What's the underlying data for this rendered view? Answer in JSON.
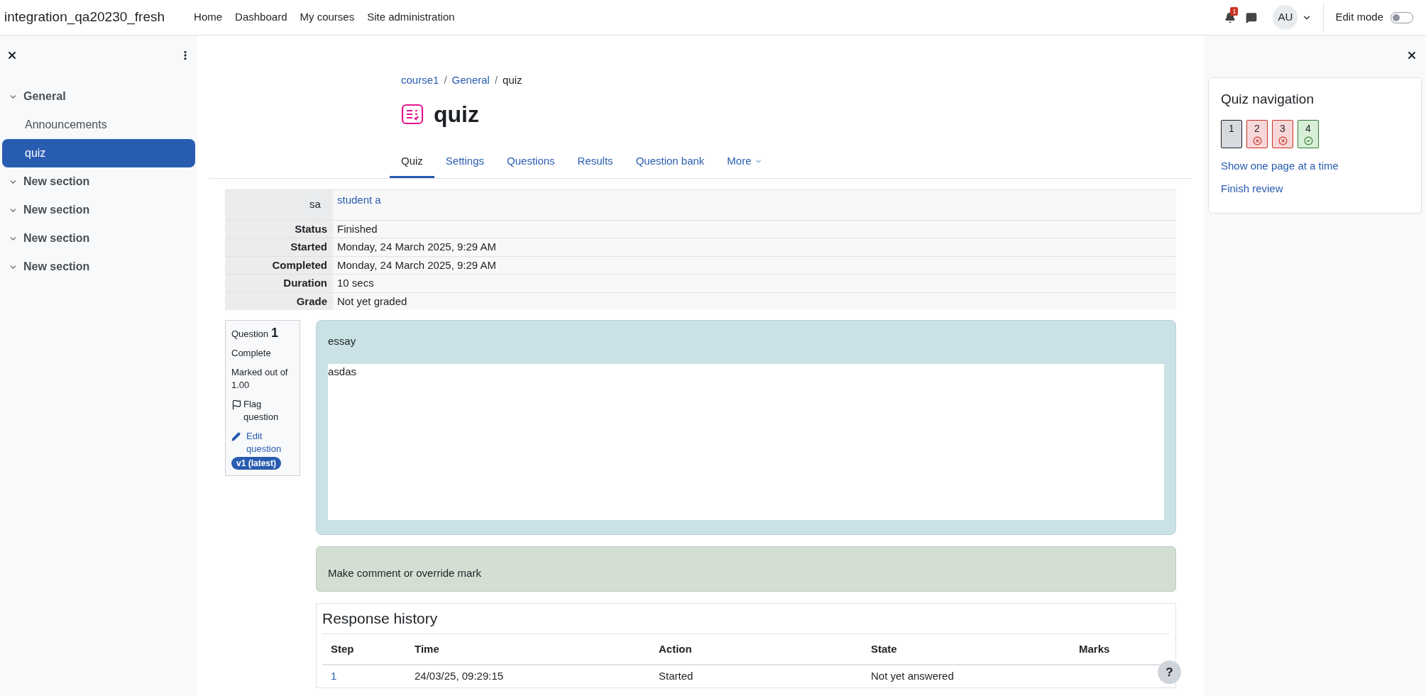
{
  "navbar": {
    "site_name": "integration_qa20230_fresh",
    "links": [
      "Home",
      "Dashboard",
      "My courses",
      "Site administration"
    ],
    "notification_count": "1",
    "avatar": "AU",
    "edit_mode": {
      "label": "Edit mode",
      "on": false
    }
  },
  "course_index": {
    "sections": [
      {
        "title": "General",
        "expanded": true,
        "children": [
          {
            "label": "Announcements",
            "selected": false
          },
          {
            "label": "quiz",
            "selected": true
          }
        ]
      },
      {
        "title": "New section",
        "expanded": true
      },
      {
        "title": "New section",
        "expanded": true
      },
      {
        "title": "New section",
        "expanded": true
      },
      {
        "title": "New section",
        "expanded": true
      }
    ]
  },
  "breadcrumb": {
    "separator": "/",
    "items": [
      "course1",
      "General",
      "quiz"
    ]
  },
  "page_title": "quiz",
  "tabs": [
    {
      "label": "Quiz",
      "selected": true
    },
    {
      "label": "Settings",
      "selected": false
    },
    {
      "label": "Questions",
      "selected": false
    },
    {
      "label": "Results",
      "selected": false
    },
    {
      "label": "Question bank",
      "selected": false
    },
    {
      "label": "More",
      "selected": false
    }
  ],
  "summary": {
    "avatar": "sa",
    "user": "student a",
    "rows": [
      {
        "label": "Status",
        "value": "Finished"
      },
      {
        "label": "Started",
        "value": "Monday, 24 March 2025, 9:29 AM"
      },
      {
        "label": "Completed",
        "value": "Monday, 24 March 2025, 9:29 AM"
      },
      {
        "label": "Duration",
        "value": "10 secs"
      },
      {
        "label": "Grade",
        "value": "Not yet graded"
      }
    ]
  },
  "question": {
    "label": "Question",
    "number": "1",
    "state": "Complete",
    "marked": "Marked out of 1.00",
    "flag": "Flag question",
    "edit": "Edit question",
    "version": "v1 (latest)",
    "text": "essay",
    "answer": "asdas",
    "comment": "Make comment or override mark"
  },
  "response_history": {
    "title": "Response history",
    "columns": [
      "Step",
      "Time",
      "Action",
      "State",
      "Marks"
    ],
    "rows": [
      [
        "1",
        "24/03/25, 09:29:15",
        "Started",
        "Not yet answered",
        ""
      ]
    ]
  },
  "help_button": "?",
  "quiz_navigation": {
    "title": "Quiz navigation",
    "buttons": [
      {
        "label": "1",
        "kind": "current"
      },
      {
        "label": "2",
        "kind": "incorrect"
      },
      {
        "label": "3",
        "kind": "incorrect"
      },
      {
        "label": "4",
        "kind": "correct"
      }
    ],
    "links": [
      "Show one page at a time",
      "Finish review"
    ]
  }
}
